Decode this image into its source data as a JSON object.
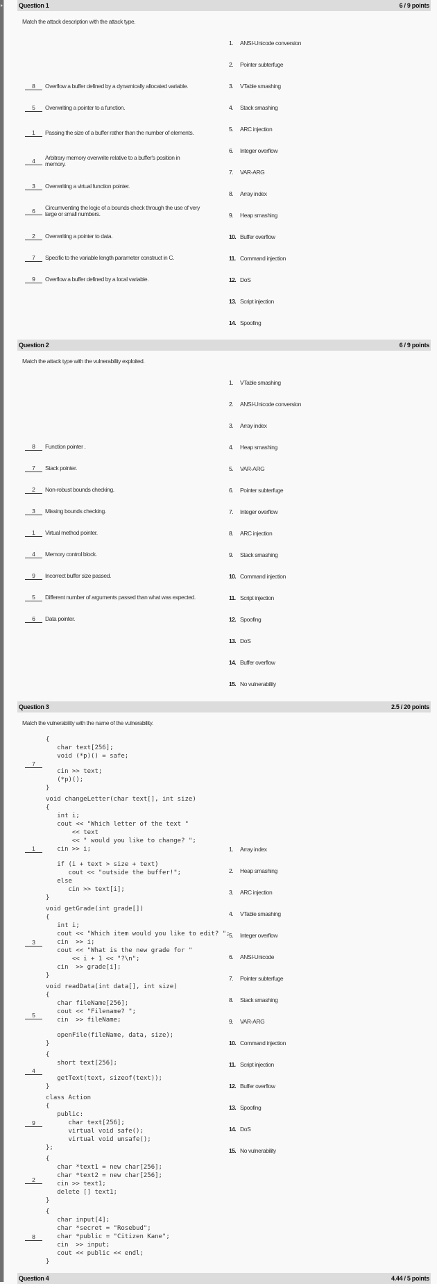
{
  "questions": [
    {
      "title": "Question 1",
      "points": "6 / 9 points",
      "prompt": "Match the attack description with the attack type.",
      "left": [
        {
          "answer": "8",
          "text": "Overflow a buffer defined by a dynamically allocated variable."
        },
        {
          "answer": "5",
          "text": "Overwriting a pointer to a function."
        },
        {
          "answer": "1",
          "text": "Passing the size of a buffer rather than the number of elements."
        },
        {
          "answer": "4",
          "text": "Arbitrary memory overwrite relative to a buffer's position in memory."
        },
        {
          "answer": "3",
          "text": "Overwriting a virtual function pointer."
        },
        {
          "answer": "6",
          "text": "Circumventing the logic of a bounds check through the use of very large or small numbers."
        },
        {
          "answer": "2",
          "text": "Overwriting a pointer to data."
        },
        {
          "answer": "7",
          "text": "Specific to the variable length parameter construct in C."
        },
        {
          "answer": "9",
          "text": "Overflow a buffer defined by a local variable."
        }
      ],
      "right": [
        "ANSI-Unicode conversion",
        "Pointer subterfuge",
        "VTable smashing",
        "Stack smashing",
        "ARC injection",
        "Integer overflow",
        "VAR-ARG",
        "Array index",
        "Heap smashing",
        "Buffer overflow",
        "Command injection",
        "DoS",
        "Script injection",
        "Spoofing"
      ]
    },
    {
      "title": "Question 2",
      "points": "6 / 9 points",
      "prompt": "Match the attack type with the vulnerability exploited.",
      "left": [
        {
          "answer": "8",
          "text": "Function pointer ."
        },
        {
          "answer": "7",
          "text": "Stack pointer."
        },
        {
          "answer": "2",
          "text": "Non-robust bounds checking."
        },
        {
          "answer": "3",
          "text": "Missing bounds checking."
        },
        {
          "answer": "1",
          "text": "Virtual method pointer."
        },
        {
          "answer": "4",
          "text": "Memory control block."
        },
        {
          "answer": "9",
          "text": "Incorrect buffer size passed."
        },
        {
          "answer": "5",
          "text": "Different number of arguments passed than what was expected."
        },
        {
          "answer": "6",
          "text": "Data pointer."
        }
      ],
      "right": [
        "VTable smashing",
        "ANSI-Unicode conversion",
        "Array index",
        "Heap smashing",
        "VAR-ARG",
        "Pointer subterfuge",
        "Integer overflow",
        "ARC injection",
        "Stack smashing",
        "Command injection",
        "Script injection",
        "Spoofing",
        "DoS",
        "Buffer overflow",
        "No vulnerability"
      ]
    },
    {
      "title": "Question 3",
      "points": "2.5 / 20 points",
      "prompt": "Match the vulnerability with the name of the vulnerability.",
      "blocks": [
        {
          "answer": "7",
          "lines": [
            "{",
            "   char text[256];",
            "   void (*p)() = safe;",
            "",
            "   cin >> text;",
            "   (*p)();",
            "}"
          ]
        },
        {
          "answer": "1",
          "lines": [
            "void changeLetter(char text[], int size)",
            "{",
            "   int i;",
            "   cout << \"Which letter of the text \"",
            "       << text",
            "       << \" would you like to change? \";",
            "   cin >> i;",
            "",
            "   if (i + text > size + text)",
            "      cout << \"outside the buffer!\";",
            "   else",
            "      cin >> text[i];",
            "}"
          ]
        },
        {
          "answer": "3",
          "lines": [
            "void getGrade(int grade[])",
            "{",
            "   int i;",
            "   cout << \"Which item would you like to edit? \";",
            "   cin  >> i;",
            "   cout << \"What is the new grade for \"",
            "       << i + 1 << \"?\\n\";",
            "   cin  >> grade[i];",
            "}"
          ]
        },
        {
          "answer": "5",
          "lines": [
            "void readData(int data[], int size)",
            "{",
            "   char fileName[256];",
            "   cout << \"Filename? \";",
            "   cin  >> fileName;",
            "",
            "   openFile(fileName, data, size);",
            "}"
          ]
        },
        {
          "answer": "4",
          "lines": [
            "{",
            "   short text[256];",
            "",
            "   getText(text, sizeof(text));",
            "}"
          ]
        },
        {
          "answer": "9",
          "lines": [
            "class Action",
            "{",
            "   public:",
            "      char text[256];",
            "      virtual void safe();",
            "      virtual void unsafe();",
            "};"
          ]
        },
        {
          "answer": "2",
          "lines": [
            "{",
            "   char *text1 = new char[256];",
            "   char *text2 = new char[256];",
            "   cin >> text1;",
            "   delete [] text1;",
            "}"
          ]
        },
        {
          "answer": "8",
          "lines": [
            "{",
            "   char input[4];",
            "   char *secret = \"Rosebud\";",
            "   char *public = \"Citizen Kane\";",
            "   cin  >> input;",
            "   cout << public << endl;",
            "}"
          ]
        }
      ],
      "right": [
        "Array index",
        "Heap smashing",
        "ARC injection",
        "VTable smashing",
        "Integer overflow",
        "ANSI-Unicode",
        "Pointer subterfuge",
        "Stack smashing",
        "VAR-ARG",
        "Command injection",
        "Script injection",
        "Buffer overflow",
        "Spoofing",
        "DoS",
        "No vulnerability"
      ]
    },
    {
      "title": "Question 4",
      "points": "4.44 / 5 points"
    }
  ],
  "colors": {
    "header_bg": "#dcdcdc",
    "page_bg": "#f9f9f9",
    "text": "#333333"
  }
}
